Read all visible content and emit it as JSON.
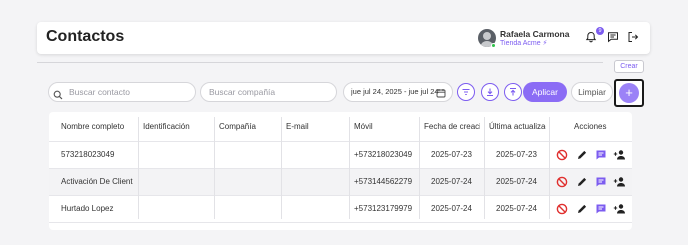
{
  "header": {
    "title": "Contactos",
    "user_name": "Rafaela Carmona",
    "store": "Tienda Acme ⚡",
    "notification_count": "9"
  },
  "filters": {
    "search_placeholder": "Buscar contacto",
    "company_placeholder": "Buscar compañía",
    "date_range": "jue jul 24, 2025 - jue jul 24, 2025",
    "apply_label": "Aplicar",
    "clear_label": "Limpiar",
    "create_tooltip": "Crear",
    "create_label": "+"
  },
  "table": {
    "columns": [
      "Nombre completo",
      "Identificación",
      "Compañía",
      "E-mail",
      "Móvil",
      "Fecha de creación",
      "Última actualización",
      "Acciones"
    ],
    "rows": [
      {
        "name": "573218023049",
        "id": "",
        "company": "",
        "email": "",
        "mobile": "+573218023049",
        "created": "2025-07-23",
        "updated": "2025-07-23"
      },
      {
        "name": "Activación De Client",
        "id": "",
        "company": "",
        "email": "",
        "mobile": "+573144562279",
        "created": "2025-07-24",
        "updated": "2025-07-24"
      },
      {
        "name": "Hurtado Lopez",
        "id": "",
        "company": "",
        "email": "",
        "mobile": "+573123179979",
        "created": "2025-07-24",
        "updated": "2025-07-24"
      }
    ]
  },
  "colors": {
    "accent": "#8b6cf5",
    "danger": "#e0302f",
    "online": "#2ec24a"
  }
}
